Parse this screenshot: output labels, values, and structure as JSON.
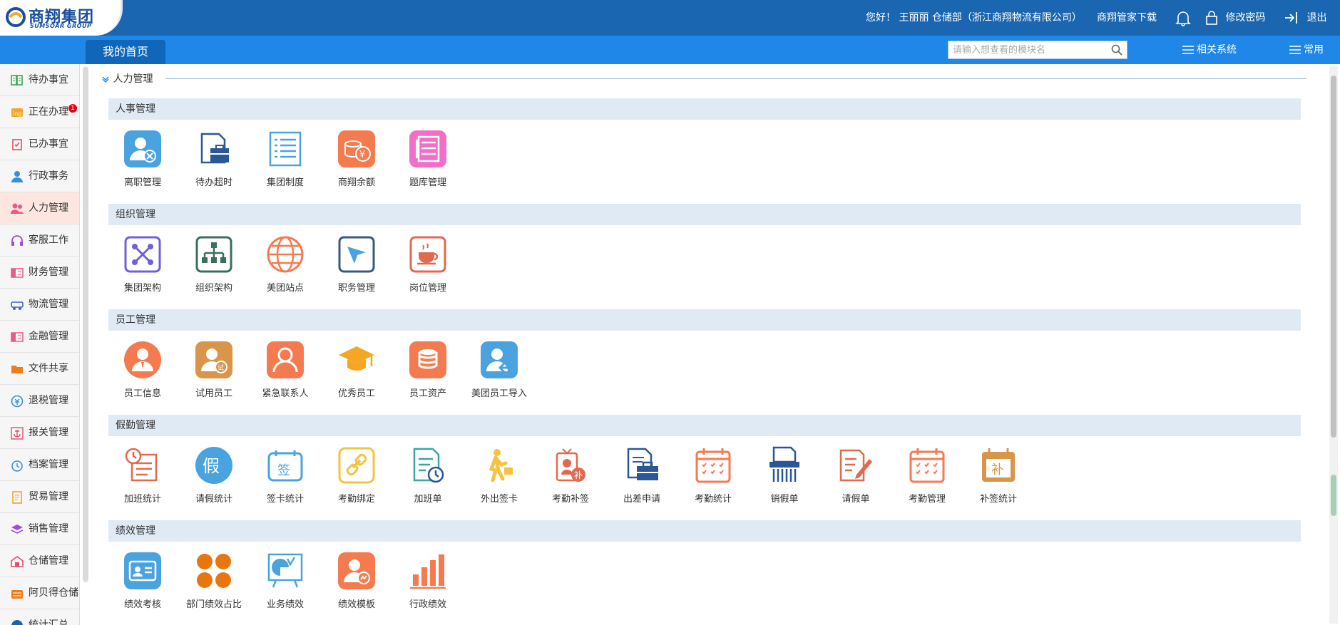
{
  "header": {
    "brand_name": "商翔集团",
    "brand_en": "SUMSOAR GROUP",
    "greeting": "您好！ 王丽丽 仓储部（浙江商翔物流有限公司）",
    "download_label": "商翔管家下载",
    "change_password_label": "修改密码",
    "logout_label": "退出"
  },
  "navbar": {
    "home_tab": "我的首页",
    "search_placeholder": "请输入想查看的模块名",
    "related_systems": "相关系统",
    "common": "常用"
  },
  "sidebar": {
    "items": [
      {
        "label": "待办事宜",
        "icon": "book-icon",
        "color": "#3aa655"
      },
      {
        "label": "正在办理",
        "icon": "ing-icon",
        "color": "#f5a623",
        "badge": "1"
      },
      {
        "label": "已办事宜",
        "icon": "clipboard-check-icon",
        "color": "#e0506a"
      },
      {
        "label": "行政事务",
        "icon": "user-icon",
        "color": "#3b8fd9"
      },
      {
        "label": "人力管理",
        "icon": "people-icon",
        "color": "#e85a8a",
        "active": true
      },
      {
        "label": "客服工作",
        "icon": "headset-icon",
        "color": "#9b4fd6"
      },
      {
        "label": "财务管理",
        "icon": "money-icon",
        "color": "#e85a8a"
      },
      {
        "label": "物流管理",
        "icon": "truck-icon",
        "color": "#4a63c9"
      },
      {
        "label": "金融管理",
        "icon": "finance-icon",
        "color": "#e85a8a"
      },
      {
        "label": "文件共享",
        "icon": "folder-icon",
        "color": "#f07c1a"
      },
      {
        "label": "退税管理",
        "icon": "tax-refund-icon",
        "color": "#3b8fd9"
      },
      {
        "label": "报关管理",
        "icon": "anchor-icon",
        "color": "#e0506a"
      },
      {
        "label": "档案管理",
        "icon": "clock-icon",
        "color": "#3b8fd9"
      },
      {
        "label": "贸易管理",
        "icon": "document-icon",
        "color": "#f5a623"
      },
      {
        "label": "销售管理",
        "icon": "layers-icon",
        "color": "#9b4fd6"
      },
      {
        "label": "仓储管理",
        "icon": "warehouse-icon",
        "color": "#e0506a"
      },
      {
        "label": "阿贝得仓储",
        "icon": "storage-icon",
        "color": "#f07c1a"
      },
      {
        "label": "统计汇总",
        "icon": "pie-icon",
        "color": "#1a66b1"
      }
    ]
  },
  "main": {
    "section_title": "人力管理",
    "groups": [
      {
        "title": "人事管理",
        "tiles": [
          {
            "label": "离职管理",
            "icon": "user-remove-icon",
            "color": "#4aa3df"
          },
          {
            "label": "待办超时",
            "icon": "briefcase-doc-icon",
            "color": "#2b5797"
          },
          {
            "label": "集团制度",
            "icon": "list-doc-icon",
            "color": "#4aa3df"
          },
          {
            "label": "商翔余额",
            "icon": "coins-yen-icon",
            "color": "#f47b50"
          },
          {
            "label": "题库管理",
            "icon": "question-bank-icon",
            "color": "#f36ec8"
          }
        ]
      },
      {
        "title": "组织管理",
        "tiles": [
          {
            "label": "集团架构",
            "icon": "network-node-icon",
            "color": "#6f5fd8"
          },
          {
            "label": "组织架构",
            "icon": "org-chart-icon",
            "color": "#3c6e5c"
          },
          {
            "label": "美团站点",
            "icon": "globe-icon",
            "color": "#f47b50"
          },
          {
            "label": "职务管理",
            "icon": "send-icon",
            "color": "#3a5a78"
          },
          {
            "label": "岗位管理",
            "icon": "coffee-icon",
            "color": "#e06a4e"
          }
        ]
      },
      {
        "title": "员工管理",
        "tiles": [
          {
            "label": "员工信息",
            "icon": "employee-icon",
            "color": "#f47b50"
          },
          {
            "label": "试用员工",
            "icon": "trial-employee-icon",
            "color": "#d9954a"
          },
          {
            "label": "紧急联系人",
            "icon": "contact-icon",
            "color": "#f47b50"
          },
          {
            "label": "优秀员工",
            "icon": "graduation-cap-icon",
            "color": "#f5a623"
          },
          {
            "label": "员工资产",
            "icon": "assets-icon",
            "color": "#f47b50"
          },
          {
            "label": "美团员工导入",
            "icon": "user-import-icon",
            "color": "#4aa3df"
          }
        ]
      },
      {
        "title": "假勤管理",
        "tiles": [
          {
            "label": "加班统计",
            "icon": "overtime-icon",
            "color": "#e06a4e"
          },
          {
            "label": "请假统计",
            "icon": "leave-icon",
            "color": "#4aa3df"
          },
          {
            "label": "签卡统计",
            "icon": "sign-card-icon",
            "color": "#4aa3df"
          },
          {
            "label": "考勤绑定",
            "icon": "link-icon",
            "color": "#f5c242"
          },
          {
            "label": "加班单",
            "icon": "overtime-form-icon",
            "color": "#3aa6a0"
          },
          {
            "label": "外出签卡",
            "icon": "walking-icon",
            "color": "#f5c242"
          },
          {
            "label": "考勤补签",
            "icon": "badge-supplement-icon",
            "color": "#e06a4e"
          },
          {
            "label": "出差申请",
            "icon": "business-trip-icon",
            "color": "#2b5797"
          },
          {
            "label": "考勤统计",
            "icon": "calendar-icon",
            "color": "#f47b50"
          },
          {
            "label": "销假单",
            "icon": "shredder-icon",
            "color": "#2b5797"
          },
          {
            "label": "请假单",
            "icon": "edit-doc-icon",
            "color": "#e06a4e"
          },
          {
            "label": "考勤管理",
            "icon": "calendar-icon",
            "color": "#f47b50"
          },
          {
            "label": "补签统计",
            "icon": "calendar-supplement-icon",
            "color": "#d9954a"
          }
        ]
      },
      {
        "title": "绩效管理",
        "tiles": [
          {
            "label": "绩效考核",
            "icon": "id-card-icon",
            "color": "#4aa3df"
          },
          {
            "label": "部门绩效占比",
            "icon": "clover-icon",
            "color": "#e8760e"
          },
          {
            "label": "业务绩效",
            "icon": "pie-board-icon",
            "color": "#4aa3df"
          },
          {
            "label": "绩效模板",
            "icon": "user-chart-icon",
            "color": "#f47b50"
          },
          {
            "label": "行政绩效",
            "icon": "bar-chart-icon",
            "color": "#f47b50"
          }
        ]
      }
    ]
  }
}
